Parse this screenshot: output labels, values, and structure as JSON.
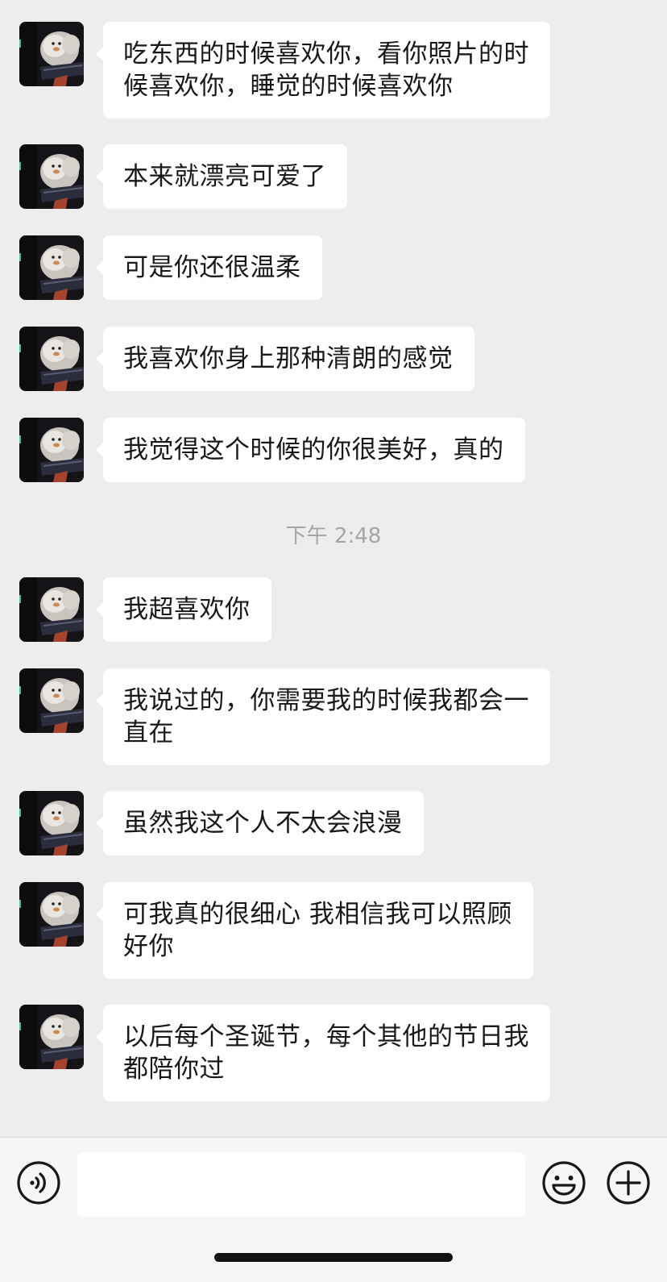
{
  "messages": [
    {
      "lines": [
        "吃东西的时候喜欢你，看你照片的时",
        "候喜欢你，睡觉的时候喜欢你"
      ]
    },
    {
      "lines": [
        "本来就漂亮可爱了"
      ]
    },
    {
      "lines": [
        "可是你还很温柔"
      ]
    },
    {
      "lines": [
        "我喜欢你身上那种清朗的感觉"
      ]
    },
    {
      "lines": [
        "我觉得这个时候的你很美好，真的"
      ]
    },
    {
      "lines": [
        "我超喜欢你"
      ]
    },
    {
      "lines": [
        "我说过的，你需要我的时候我都会一",
        "直在"
      ]
    },
    {
      "lines": [
        "虽然我这个人不太会浪漫"
      ]
    },
    {
      "lines": [
        "可我真的很细心 我相信我可以照顾",
        "好你"
      ]
    },
    {
      "lines": [
        "以后每个圣诞节，每个其他的节日我",
        "都陪你过"
      ]
    }
  ],
  "timestamp": "下午 2:48",
  "input_bar": {
    "message_value": "",
    "voice_icon": "voice-icon",
    "emoji_icon": "emoji-icon",
    "plus_icon": "plus-icon"
  },
  "colors": {
    "background": "#ededed",
    "bubble": "#ffffff",
    "text": "#191919",
    "timestamp": "#a5a5a5"
  }
}
